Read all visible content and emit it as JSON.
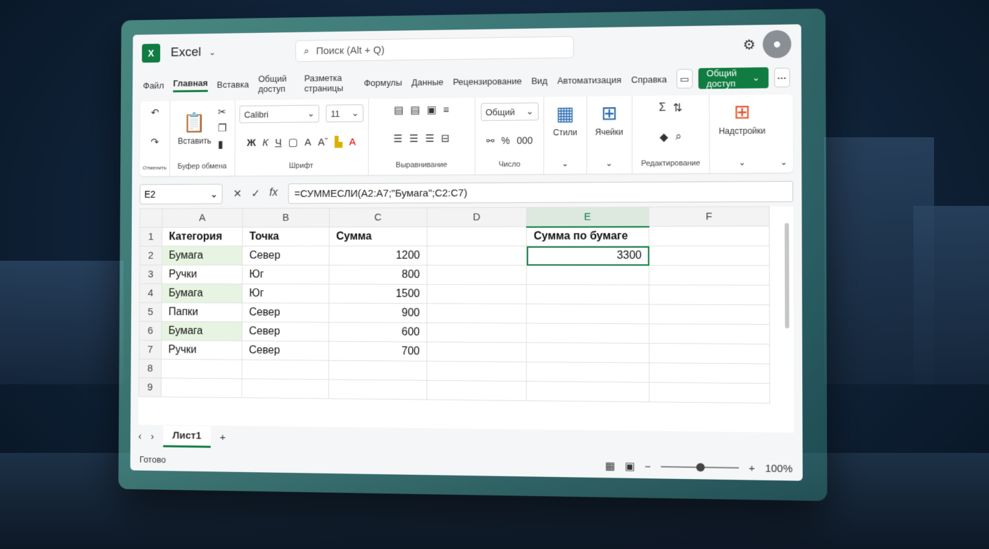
{
  "app": {
    "name": "Excel",
    "logo": "X"
  },
  "search": {
    "placeholder": "Поиск (Alt + Q)"
  },
  "tabs": [
    "Файл",
    "Главная",
    "Вставка",
    "Общий доступ",
    "Разметка страницы",
    "Формулы",
    "Данные",
    "Рецензирование",
    "Вид",
    "Автоматизация",
    "Справка"
  ],
  "share_label": "Общий доступ",
  "ribbon": {
    "undo_label": "Отменить",
    "paste_label": "Вставить",
    "clipboard_label": "Буфер обмена",
    "font_name": "Calibri",
    "font_size": "11",
    "font_label": "Шрифт",
    "align_label": "Выравнивание",
    "number_format": "Общий",
    "number_label": "Число",
    "styles_label": "Стили",
    "cells_label": "Ячейки",
    "editing_label": "Редактирование",
    "addins_label": "Надстройки",
    "bold": "Ж",
    "italic": "К",
    "underline": "Ч"
  },
  "formula_bar": {
    "cell": "E2",
    "formula": "=СУММЕСЛИ(A2:A7;\"Бумага\";C2:C7)"
  },
  "grid": {
    "columns": [
      "A",
      "B",
      "C",
      "D",
      "E",
      "F"
    ],
    "rows": [
      {
        "n": "1",
        "a": "Категория",
        "b": "Точка",
        "c": "Сумма",
        "e": "Сумма по бумаге"
      },
      {
        "n": "2",
        "a": "Бумага",
        "b": "Север",
        "c": "1200",
        "e": "3300"
      },
      {
        "n": "3",
        "a": "Ручки",
        "b": "Юг",
        "c": "800",
        "e": ""
      },
      {
        "n": "4",
        "a": "Бумага",
        "b": "Юг",
        "c": "1500",
        "e": ""
      },
      {
        "n": "5",
        "a": "Папки",
        "b": "Север",
        "c": "900",
        "e": ""
      },
      {
        "n": "6",
        "a": "Бумага",
        "b": "Север",
        "c": "600",
        "e": ""
      },
      {
        "n": "7",
        "a": "Ручки",
        "b": "Север",
        "c": "700",
        "e": ""
      },
      {
        "n": "8",
        "a": "",
        "b": "",
        "c": "",
        "e": ""
      },
      {
        "n": "9",
        "a": "",
        "b": "",
        "c": "",
        "e": ""
      }
    ]
  },
  "sheets": {
    "active": "Лист1",
    "add": "+"
  },
  "status": {
    "ready": "Готово",
    "zoom": "100%"
  },
  "colors": {
    "accent": "#107c41",
    "highlight": "#e6f4e1"
  }
}
